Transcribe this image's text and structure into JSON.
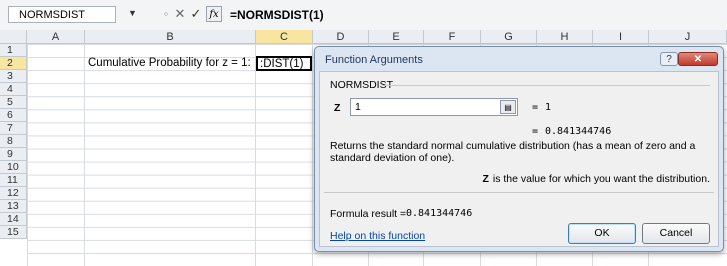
{
  "formula_bar": {
    "name_box": "NORMSDIST",
    "cancel_glyph": "✕",
    "enter_glyph": "✓",
    "fx_label": "fx",
    "formula": "=NORMSDIST(1)"
  },
  "grid": {
    "columns": [
      "A",
      "B",
      "C",
      "D",
      "E",
      "F",
      "G",
      "H",
      "I",
      "J"
    ],
    "rows": [
      "1",
      "2",
      "3",
      "4",
      "5",
      "6",
      "7",
      "8",
      "9",
      "10",
      "11",
      "12",
      "13",
      "14",
      "15"
    ],
    "active_column": "C",
    "active_row": "2",
    "label_cell": "Cumulative Probability for z = 1:",
    "editing_cell": ":DIST(1)"
  },
  "dialog": {
    "title": "Function Arguments",
    "help_glyph": "?",
    "close_glyph": "✕",
    "group_title": "NORMSDIST",
    "arg_name": "Z",
    "arg_value": "1",
    "arg_equals": "=",
    "arg_result": "1",
    "result_equals": "=",
    "result_value": "0.841344746",
    "description": "Returns the standard normal cumulative distribution (has a mean of zero and a standard deviation of one).",
    "arg_desc_name": "Z",
    "arg_desc_text": "is the value for which you want the distribution.",
    "formula_result_label": "Formula result =",
    "formula_result_value": "0.841344746",
    "help_link": "Help on this function",
    "ok_label": "OK",
    "cancel_label": "Cancel"
  }
}
